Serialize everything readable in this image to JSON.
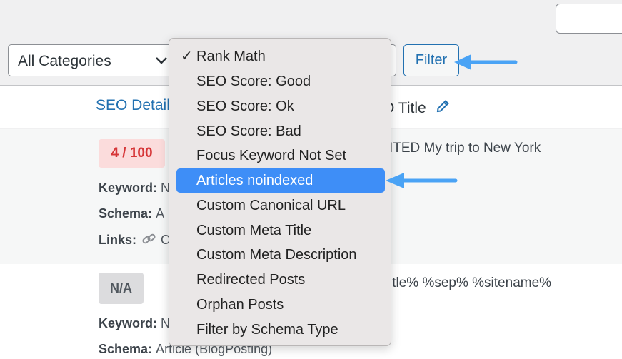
{
  "toolbar": {
    "category_select": {
      "value": "All Categories"
    },
    "filter_label": "Filter"
  },
  "table": {
    "columns": {
      "seo_details": "SEO Detail",
      "seo_title": "O Title"
    },
    "rows": [
      {
        "score": "4 / 100",
        "title": "ITED My trip to New York",
        "keyword_label": "Keyword:",
        "keyword_value": "N",
        "schema_label": "Schema:",
        "schema_value": "A",
        "links_label": "Links:",
        "links_value": "C"
      },
      {
        "score": "N/A",
        "title": "itle% %sep% %sitename%",
        "keyword_label": "Keyword:",
        "keyword_value": "N",
        "schema_label": "Schema:",
        "schema_value": "Article (BlogPosting)"
      }
    ]
  },
  "dropdown": {
    "check_glyph": "✓",
    "selected_index": 5,
    "options": [
      "Rank Math",
      "SEO Score: Good",
      "SEO Score: Ok",
      "SEO Score: Bad",
      "Focus Keyword Not Set",
      "Articles noindexed",
      "Custom Canonical URL",
      "Custom Meta Title",
      "Custom Meta Description",
      "Redirected Posts",
      "Orphan Posts",
      "Filter by Schema Type"
    ]
  },
  "colors": {
    "accent": "#2271b1",
    "highlight": "#3e8ef7",
    "arrow": "#4aa3f5",
    "score_bad": "#d63638"
  }
}
